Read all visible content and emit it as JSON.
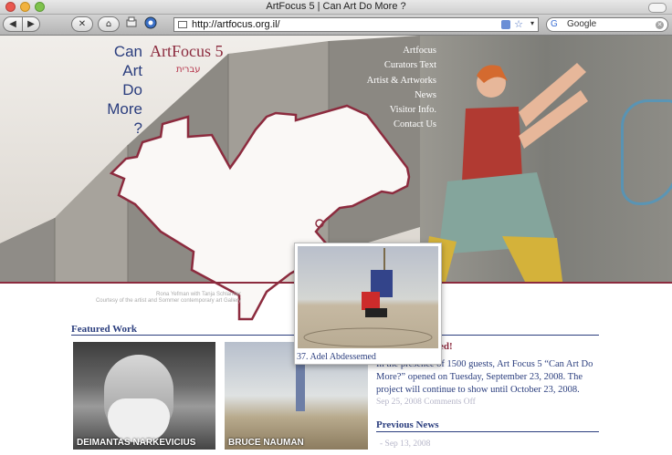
{
  "window": {
    "title": "ArtFocus 5 | Can Art Do More ?"
  },
  "toolbar": {
    "back_icon": "◀",
    "forward_icon": "▶",
    "reload_icon": "✕",
    "home_icon": "⌂",
    "url": "http://artfocus.org.il/",
    "search_engine": "G",
    "search_placeholder": "Google"
  },
  "site": {
    "question": "Can\nArt\nDo\nMore\n?",
    "name": "ArtFocus 5",
    "hebrew": "עברית",
    "nav": [
      "Artfocus",
      "Curators Text",
      "Artist & Artworks",
      "News",
      "Visitor Info.",
      "Contact Us"
    ],
    "credit": "Rona Yefman with Tanja Schlander\nCourtesy of the artist and Sommer contemporary art Gallery"
  },
  "featured": {
    "heading": "Featured Work",
    "items": [
      {
        "label": "DEIMANTAS NARKEVICIUS"
      },
      {
        "label": "BRUCE NAUMAN"
      }
    ]
  },
  "popup": {
    "caption": "37. Adel Abdessemed"
  },
  "news": {
    "heading_fragment": "ened!",
    "body": "In the presence of 1500 guests,  Art Focus 5 “Can Art Do More?” opened on Tuesday, September 23,  2008. The project will continue to show until October 23, 2008.",
    "date": "Sep 25, 2008 Comments Off",
    "previous_heading": "Previous News",
    "previous_date": "- Sep 13, 2008"
  },
  "colors": {
    "accent_red": "#8c2b3e",
    "accent_blue": "#2b3e7e"
  }
}
